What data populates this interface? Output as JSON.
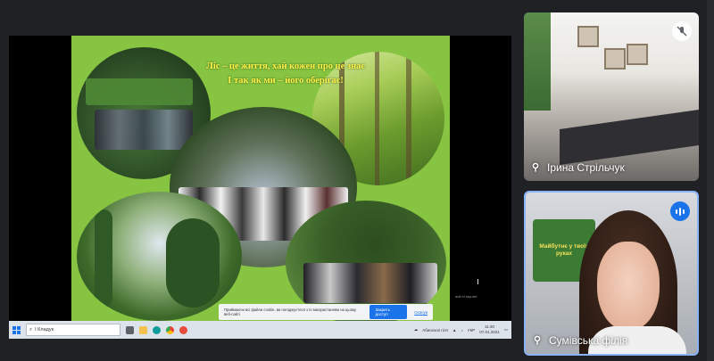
{
  "slide": {
    "title_line1": "Ліс – це життя, хай кожен про це знає",
    "title_line2": "І так як ми – його оберігає!",
    "cookie_text": "Приймаючи всі файли cookie, ви погоджуєтеся з їх використанням на цьому веб-сайті",
    "cookie_accept": "Закрить доступ",
    "cookie_close": "Скасув",
    "side_note": "aoif ei rayurre"
  },
  "taskbar": {
    "search_text": "І Кладук",
    "weather": "Абиоскоп гілп",
    "lang": "УКР",
    "time": "11:40",
    "date": "07.01.2021"
  },
  "participants": [
    {
      "name": "Ірина Стрільчук",
      "muted": true
    },
    {
      "name": "Сумівська філія",
      "speaking": true,
      "board_text": "Майбутнє у твоїх руках"
    }
  ],
  "colors": {
    "slide_bg": "#86c441",
    "title": "#fff34a",
    "active_border": "#8ab4f8",
    "accent": "#1a73e8"
  }
}
